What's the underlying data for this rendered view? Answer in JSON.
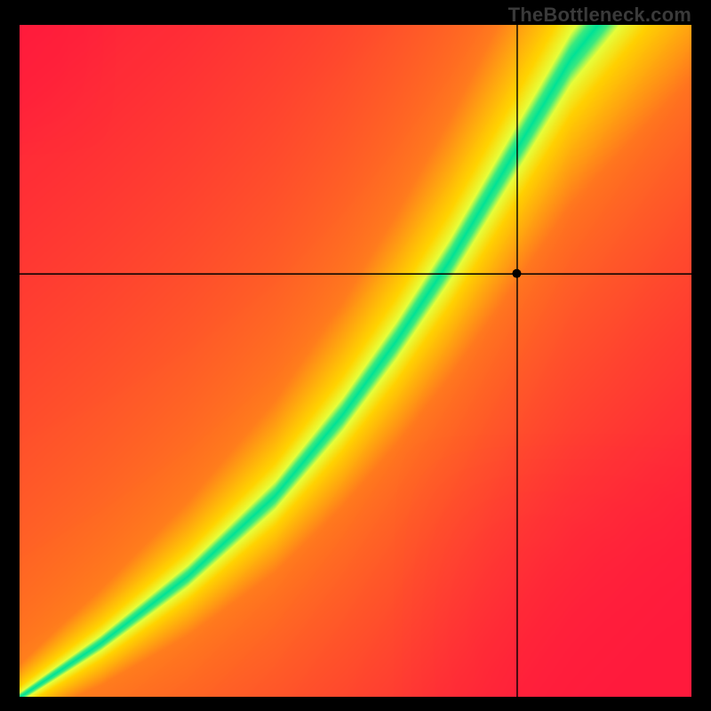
{
  "watermark": "TheBottleneck.com",
  "chart_data": {
    "type": "heatmap",
    "title": "",
    "xlabel": "",
    "ylabel": "",
    "xlim": [
      0,
      100
    ],
    "ylim": [
      0,
      100
    ],
    "grid": false,
    "marker": {
      "x": 74,
      "y": 63,
      "note": "crosshair point (percent of plot area, origin bottom-left)"
    },
    "crosshair": {
      "x_percent": 74,
      "y_percent": 63
    },
    "optimal_curve": {
      "description": "green ridge of balanced CPU/GPU (percent coords, origin bottom-left)",
      "points": [
        {
          "x": 0,
          "y": 0
        },
        {
          "x": 12,
          "y": 8
        },
        {
          "x": 25,
          "y": 18
        },
        {
          "x": 38,
          "y": 30
        },
        {
          "x": 48,
          "y": 42
        },
        {
          "x": 56,
          "y": 53
        },
        {
          "x": 64,
          "y": 65
        },
        {
          "x": 70,
          "y": 75
        },
        {
          "x": 76,
          "y": 85
        },
        {
          "x": 82,
          "y": 95
        },
        {
          "x": 86,
          "y": 100
        }
      ]
    },
    "colors": {
      "low": "#ff1a3c",
      "mid": "#ffd400",
      "optimal": "#00e296",
      "band_outer": "#e6ff3a"
    },
    "legend": []
  }
}
